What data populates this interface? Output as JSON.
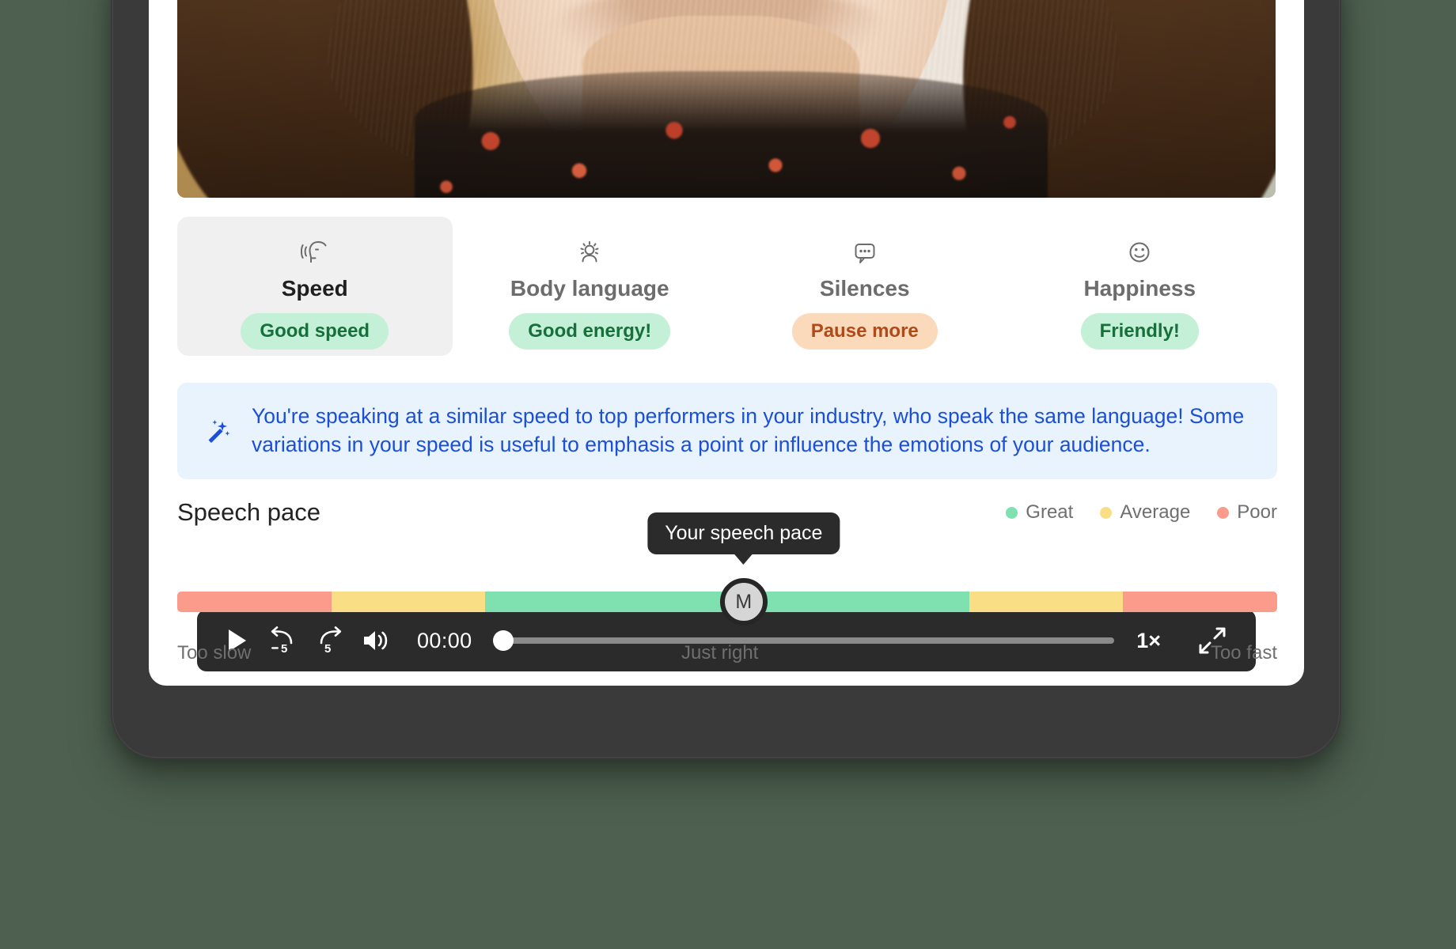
{
  "player": {
    "play_label": "play-icon",
    "rewind_label": "-5",
    "forward_label": "5",
    "volume_label": "volume-icon",
    "current_time": "00:00",
    "speed": "1×",
    "fullscreen_label": "fullscreen-icon",
    "progress_percent": 0
  },
  "metrics": [
    {
      "icon": "speaking-head-icon",
      "title": "Speed",
      "pill": "Good speed",
      "pill_style": "green",
      "selected": true
    },
    {
      "icon": "body-language-icon",
      "title": "Body language",
      "pill": "Good energy!",
      "pill_style": "green",
      "selected": false
    },
    {
      "icon": "speech-bubble-icon",
      "title": "Silences",
      "pill": "Pause more",
      "pill_style": "orange",
      "selected": false
    },
    {
      "icon": "smiley-face-icon",
      "title": "Happiness",
      "pill": "Friendly!",
      "pill_style": "green",
      "selected": false
    }
  ],
  "insight": {
    "icon": "magic-wand-icon",
    "text": "You're speaking at a similar speed to top performers in your industry, who speak the same language! Some variations in your speed is useful to emphasis a point or influence the emotions of your audience."
  },
  "speech_pace": {
    "title": "Speech pace",
    "legend": [
      {
        "label": "Great",
        "color": "#7fe0b0"
      },
      {
        "label": "Average",
        "color": "#fade86"
      },
      {
        "label": "Poor",
        "color": "#fa9b8c"
      }
    ],
    "tooltip": "Your speech pace",
    "marker_label": "M",
    "marker_position_percent": 62,
    "axis": [
      "Too slow",
      "Just right",
      "Too fast"
    ]
  },
  "chart_data": {
    "type": "bar",
    "title": "Speech pace",
    "orientation": "horizontal-scale",
    "categories": [
      "Poor (slow)",
      "Average (slow)",
      "Great",
      "Average (fast)",
      "Poor (fast)"
    ],
    "values": [
      14,
      14,
      36,
      14,
      14
    ],
    "colors": [
      "#fa9b8c",
      "#fade86",
      "#7fe0b0",
      "#fade86",
      "#fa9b8c"
    ],
    "marker": {
      "label": "M",
      "position_percent": 62,
      "tooltip": "Your speech pace"
    },
    "xlabel": "",
    "ylabel": "",
    "xlim": [
      0,
      100
    ],
    "tick_labels": [
      "Too slow",
      "Just right",
      "Too fast"
    ],
    "legend": [
      "Great",
      "Average",
      "Poor"
    ],
    "legend_position": "top-right",
    "grid": false
  }
}
